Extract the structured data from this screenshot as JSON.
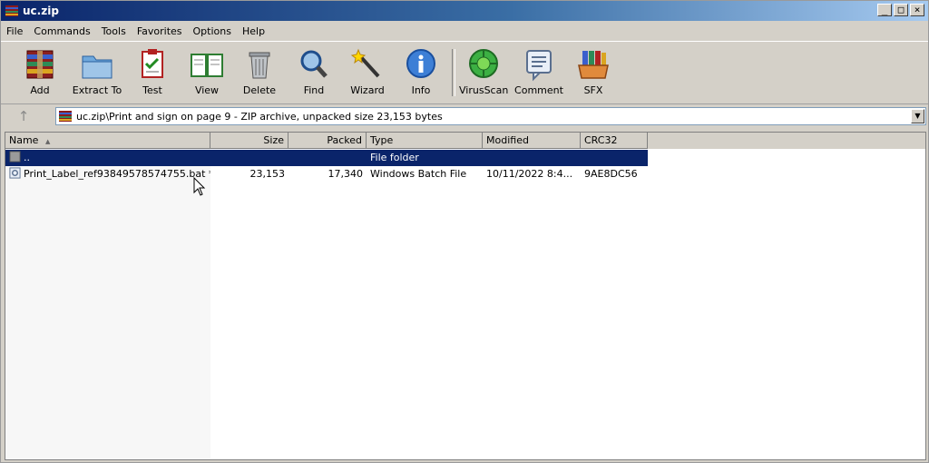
{
  "window": {
    "title": "uc.zip",
    "minimize": "_",
    "restore": "□",
    "close": "×"
  },
  "menu": [
    "File",
    "Commands",
    "Tools",
    "Favorites",
    "Options",
    "Help"
  ],
  "toolbar": {
    "add": "Add",
    "extract_to": "Extract To",
    "test": "Test",
    "view": "View",
    "delete": "Delete",
    "find": "Find",
    "wizard": "Wizard",
    "info": "Info",
    "virusscan": "VirusScan",
    "comment": "Comment",
    "sfx": "SFX"
  },
  "address": {
    "up_glyph": "↑",
    "path": "uc.zip\\Print and sign on page 9 - ZIP archive, unpacked size 23,153 bytes",
    "dropdown_glyph": "▼"
  },
  "columns": {
    "name": "Name",
    "sort_glyph": "▲",
    "size": "Size",
    "packed": "Packed",
    "type": "Type",
    "modified": "Modified",
    "crc32": "CRC32"
  },
  "rows": [
    {
      "name": "..",
      "size": "",
      "packed": "",
      "type": "File folder",
      "modified": "",
      "crc32": ""
    },
    {
      "name": "Print_Label_ref93849578574755.bat *",
      "size": "23,153",
      "packed": "17,340",
      "type": "Windows Batch File",
      "modified": "10/11/2022 8:4...",
      "crc32": "9AE8DC56"
    }
  ],
  "colors": {
    "selection": "#0a246a",
    "title_start": "#0a246a",
    "title_end": "#a6caf0"
  }
}
